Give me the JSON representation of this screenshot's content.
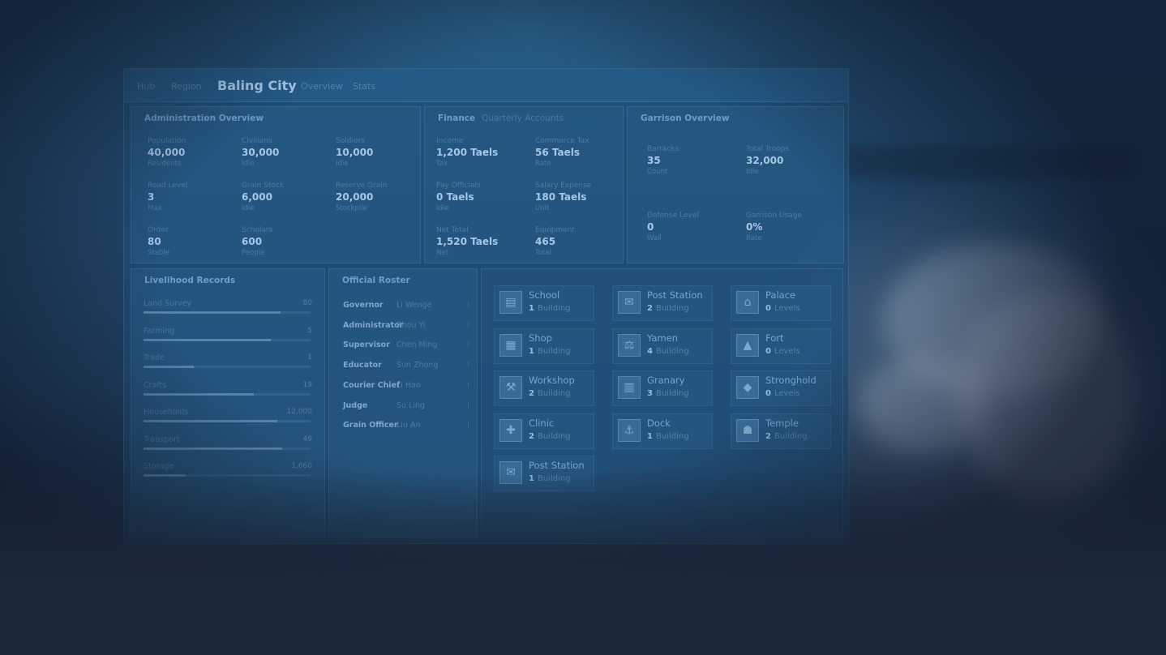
{
  "city": {
    "breadcrumb_left": [
      "Hub",
      "Region"
    ],
    "name": "Baling City",
    "breadcrumb_right": [
      "Overview",
      "Stats"
    ]
  },
  "admin": {
    "title": "Administration Overview",
    "stats": [
      {
        "label": "Population",
        "value": "40,000",
        "note": "Residents"
      },
      {
        "label": "Civilians",
        "value": "30,000",
        "note": "Idle"
      },
      {
        "label": "Soldiers",
        "value": "10,000",
        "note": "Idle"
      },
      {
        "label": "Road Level",
        "value": "3",
        "note": "Max"
      },
      {
        "label": "Grain Stock",
        "value": "6,000",
        "note": "Idle"
      },
      {
        "label": "Reserve Grain",
        "value": "20,000",
        "note": "Stockpile"
      },
      {
        "label": "Order",
        "value": "80",
        "note": "Stable"
      },
      {
        "label": "Scholars",
        "value": "600",
        "note": "People"
      }
    ]
  },
  "finance": {
    "title": "Finance",
    "subtitle": "Quarterly Accounts",
    "stats": [
      {
        "label": "Income",
        "value": "1,200 Taels",
        "note": "Tax"
      },
      {
        "label": "Commerce Tax",
        "value": "56 Taels",
        "note": "Rate"
      },
      {
        "label": "Pay Officials",
        "value": "0 Taels",
        "note": "Idle"
      },
      {
        "label": "Salary Expense",
        "value": "180 Taels",
        "note": "Unit"
      },
      {
        "label": "Net Total",
        "value": "1,520 Taels",
        "note": "Net"
      },
      {
        "label": "Equipment",
        "value": "465",
        "note": "Total"
      }
    ]
  },
  "military": {
    "title": "Garrison Overview",
    "stats": [
      {
        "label": "Barracks",
        "value": "35",
        "note": "Count"
      },
      {
        "label": "Total Troops",
        "value": "32,000",
        "note": "Idle"
      },
      {
        "label": "Defense Level",
        "value": "0",
        "note": "Wall"
      },
      {
        "label": "Garrison Usage",
        "value": "0%",
        "note": "Rate"
      }
    ]
  },
  "records": {
    "title": "Livelihood Records",
    "items": [
      {
        "label": "Land Survey",
        "value": "80",
        "fill": 0.82
      },
      {
        "label": "Farming",
        "value": "5",
        "fill": 0.76
      },
      {
        "label": "Trade",
        "value": "1",
        "fill": 0.3
      },
      {
        "label": "Crafts",
        "value": "19",
        "fill": 0.66
      },
      {
        "label": "Households",
        "value": "12,000",
        "fill": 0.8
      },
      {
        "label": "Transport",
        "value": "49",
        "fill": 0.83
      },
      {
        "label": "Storage",
        "value": "1,660",
        "fill": 0.25
      }
    ]
  },
  "roster": {
    "title": "Official Roster",
    "items": [
      {
        "role": "Governor",
        "name": "Li Wenge"
      },
      {
        "role": "Administrator",
        "name": "Zhou Yi"
      },
      {
        "role": "Supervisor",
        "name": "Chen Ming"
      },
      {
        "role": "Educator",
        "name": "Sun Zhong"
      },
      {
        "role": "Courier Chief",
        "name": "Li Hao"
      },
      {
        "role": "Judge",
        "name": "Su Ling"
      },
      {
        "role": "Grain Officer",
        "name": "Liu An"
      }
    ]
  },
  "buildings": [
    {
      "name": "School",
      "count": "1",
      "unit": "Building",
      "icon": "school-icon"
    },
    {
      "name": "Post Station",
      "count": "2",
      "unit": "Building",
      "icon": "post-station-icon"
    },
    {
      "name": "Palace",
      "count": "0",
      "unit": "Levels",
      "icon": "palace-icon"
    },
    {
      "name": "Shop",
      "count": "1",
      "unit": "Building",
      "icon": "shop-icon"
    },
    {
      "name": "Yamen",
      "count": "4",
      "unit": "Building",
      "icon": "yamen-icon"
    },
    {
      "name": "Fort",
      "count": "0",
      "unit": "Levels",
      "icon": "fort-icon"
    },
    {
      "name": "Workshop",
      "count": "2",
      "unit": "Building",
      "icon": "workshop-icon"
    },
    {
      "name": "Granary",
      "count": "3",
      "unit": "Building",
      "icon": "granary-icon"
    },
    {
      "name": "Stronghold",
      "count": "0",
      "unit": "Levels",
      "icon": "stronghold-icon"
    },
    {
      "name": "Clinic",
      "count": "2",
      "unit": "Building",
      "icon": "clinic-icon"
    },
    {
      "name": "Dock",
      "count": "1",
      "unit": "Building",
      "icon": "dock-icon"
    },
    {
      "name": "Temple",
      "count": "2",
      "unit": "Building",
      "icon": "temple-icon"
    },
    {
      "name": "Post Station",
      "count": "1",
      "unit": "Building",
      "icon": "post-station-icon"
    }
  ]
}
